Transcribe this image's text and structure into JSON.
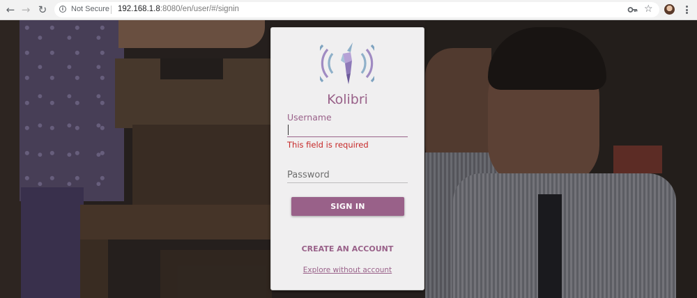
{
  "browser": {
    "security_label": "Not Secure",
    "url_host": "192.168.1.8",
    "url_rest": ":8080/en/user/#/signin"
  },
  "card": {
    "app_title": "Kolibri",
    "username_label": "Username",
    "username_value": "",
    "username_error": "This field is required",
    "password_placeholder": "Password",
    "signin_label": "SIGN IN",
    "create_account_label": "CREATE AN ACCOUNT",
    "explore_label": "Explore without account"
  },
  "colors": {
    "brand": "#996189",
    "error": "#c62828",
    "card_bg": "#f0eff0"
  },
  "icons": [
    "back-arrow-icon",
    "forward-arrow-icon",
    "reload-icon",
    "info-icon",
    "key-icon",
    "star-icon",
    "profile-avatar",
    "more-menu-icon",
    "kolibri-logo"
  ]
}
